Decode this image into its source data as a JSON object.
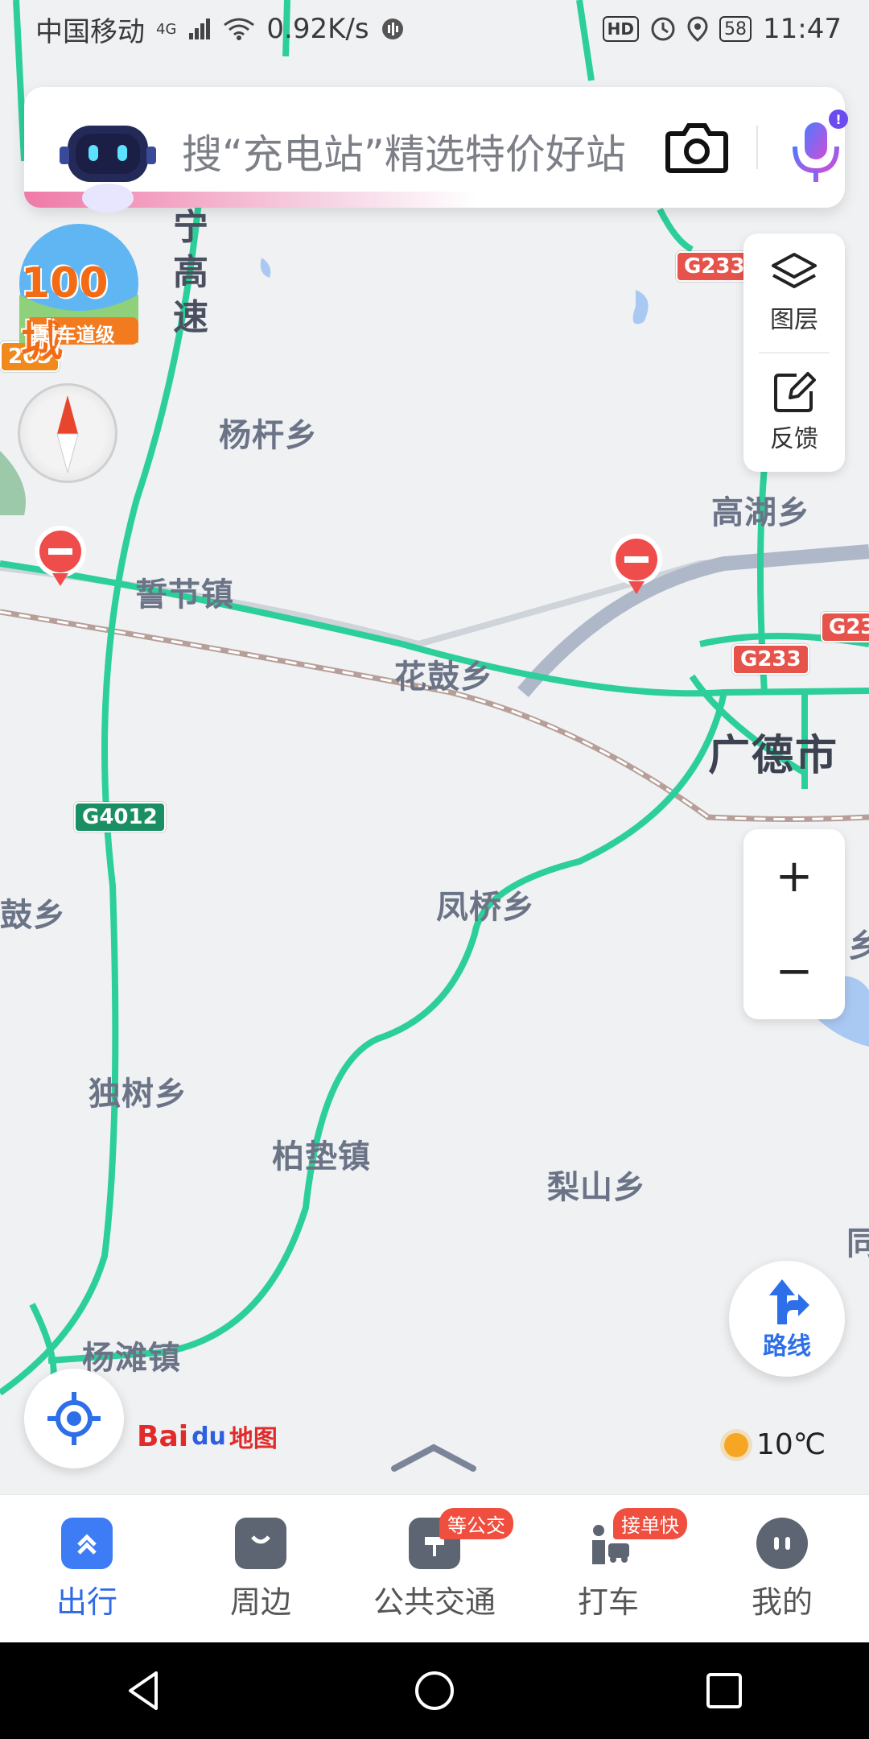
{
  "status_bar": {
    "carrier": "中国移动",
    "network": "4G",
    "speed": "0.92K/s",
    "hd_label": "HD",
    "battery": "58",
    "time": "11:47"
  },
  "search": {
    "placeholder": "搜“充电站”精选特价好站",
    "robot_icon": "robot-assistant-icon",
    "camera_icon": "camera-icon",
    "mic_icon": "microphone-icon",
    "mic_dot": "!"
  },
  "promo": {
    "title": "100城",
    "subtitle": "真|车道级"
  },
  "side_panel": {
    "layers_label": "图层",
    "feedback_label": "反馈"
  },
  "zoom": {
    "in": "+",
    "out": "−"
  },
  "map": {
    "expressway_name": "宁高速",
    "places": [
      "杨杆乡",
      "高湖乡",
      "誓节镇",
      "花鼓乡",
      "凤桥乡",
      "鼓乡",
      "独树乡",
      "柏垫镇",
      "梨山乡",
      "杨滩镇",
      "同",
      "乡"
    ],
    "city": "广德市",
    "shields": [
      "203",
      "G233",
      "G233",
      "G23",
      "G4012"
    ]
  },
  "route_button": {
    "label": "路线"
  },
  "logo": {
    "brand": "Bai",
    "suffix": "地图",
    "paw": "du"
  },
  "weather": {
    "temperature": "10℃"
  },
  "bottom_nav": [
    {
      "label": "出行",
      "badge": ""
    },
    {
      "label": "周边",
      "badge": ""
    },
    {
      "label": "公共交通",
      "badge": "等公交"
    },
    {
      "label": "打车",
      "badge": "接单快"
    },
    {
      "label": "我的",
      "badge": ""
    }
  ]
}
